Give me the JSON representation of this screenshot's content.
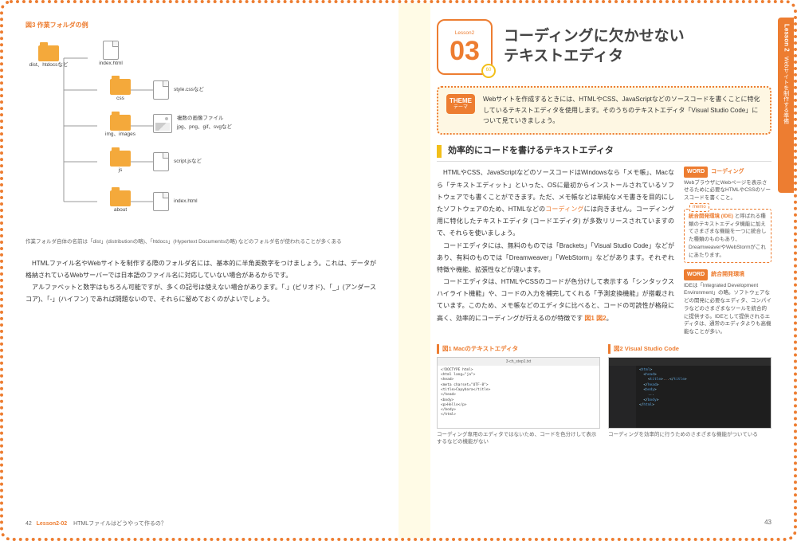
{
  "left": {
    "fig3_label": "図3 作業フォルダの例",
    "diagram": {
      "root": "dist、htdocsなど",
      "index1": "index.html",
      "css": "css",
      "style": "style.cssなど",
      "img": "img、images",
      "imgfiles_title": "複数の画像ファイル",
      "imgfiles_sub": "jpg、png、gif、svgなど",
      "js": "js",
      "script": "script.jsなど",
      "about": "about",
      "index2": "index.html"
    },
    "fig3_desc": "作業フォルダ自体の名前は「dist」(distributionの略)、「htdocs」(Hypertext Documentsの略) などのフォルダ名が使われることが多くある",
    "para1": "HTMLファイル名やWebサイトを制作する際のフォルダ名には、基本的に半角英数字をつけましょう。これは、データが格納されているWebサーバーでは日本語のファイル名に対応していない場合があるからです。",
    "para2": "アルファベットと数字はもちろん可能ですが、多くの記号は使えない場合があります。「.」(ピリオド)、「_」(アンダースコア)、「-」(ハイフン) であれば問題ないので、それらに留めておくのがよいでしょう。",
    "pagenum": "42",
    "lesson_tag": "Lesson2-02",
    "lesson_title": "HTMLファイルはどうやって作るの？"
  },
  "right": {
    "lesson_small": "Lesson2",
    "lesson_num": "03",
    "clock_min": "60",
    "headline_a": "コーディングに欠かせない",
    "headline_b": "テキストエディタ",
    "theme_tag": "THEME",
    "theme_sub": "テーマ",
    "theme_text": "Webサイトを作成するときには、HTMLやCSS、JavaScriptなどのソースコードを書くことに特化しているテキストエディタを使用します。そのうちのテキストエディタ「Visual Studio Code」について見ていきましょう。",
    "sect_title": "効率的にコードを書けるテキストエディタ",
    "p1": "HTMLやCSS、JavaScriptなどのソースコードはWindowsなら「メモ帳」、Macなら「テキストエディット」といった、OSに最初からインストールされているソフトウェアでも書くことができます。ただ、メモ帳などは単純なメモ書きを目的にしたソフトウェアのため、HTMLなどの",
    "p1_kw": "コーディング",
    "p1b": "には向きません。コーディング用に特化したテキストエディタ (コードエディタ) が多数リリースされていますので、それらを使いましょう。",
    "p2": "コードエディタには、無料のものでは「Brackets」「Visual Studio Code」などがあり、有料のものでは「Dreamweaver」「WebStorm」などがあります。それぞれ特徴や機能、拡張性などが違います。",
    "p3a": "コードエディタは、HTMLやCSSのコードが色分けして表示する「シンタックスハイライト機能」や、コードの入力を補完してくれる「予測変換機能」が搭載されています。このため、メモ帳などのエディタに比べると、コードの可読性が格段に高く、効率的にコーディングが行えるのが特徴です ",
    "p3_ref1": "図1",
    "p3_ref2": "図2",
    "p3b": "。",
    "word1_title": "コーディング",
    "word1_desc": "WebブラウザにWebページを表示させるために必要なHTMLやCSSのソースコードを書くこと。",
    "memo_label": "memo",
    "memo_hl": "統合開発環境 (IDE) ",
    "memo_text": "と呼ばれる種類のテキストエディタ機能に加えてさまざまな機能を一つに統合した種類のものもあり、DreamweaverやWebStormがこれにあたります。",
    "word2_title": "統合開発環境",
    "word2_desc": "IDEは「Integrated Development Environment」の略。ソフトウェアなどの開発に必要なエディタ、コンパイラなどのさまざまなツールを統合的に提供する。IDEとして提供されるエディタは、通常のエディタよりも高機能なことが多い。",
    "fig1_label": "図1 Macのテキストエディタ",
    "fig1_titlebar": "3-ch_step1.txt",
    "fig1_code": "<!DOCTYPE html>\n<html lang=\"ja\">\n<head>\n<meta charset=\"UTF-8\">\n<title>Capybara</title>\n</head>\n<body>\n<p>Hello</p>\n</body>\n</html>",
    "fig1_caption": "コーディング専用のエディタではないため、コードを色分けして表示するなどの機能がない",
    "fig2_label": "図2 Visual Studio Code",
    "fig2_caption": "コーディングを効率的に行うためのさまざまな機能がついている",
    "pagenum": "43",
    "side_tab_title": "Lesson 2",
    "side_tab_text": "Webサイトを制作する準備",
    "word_tag": "WORD"
  }
}
